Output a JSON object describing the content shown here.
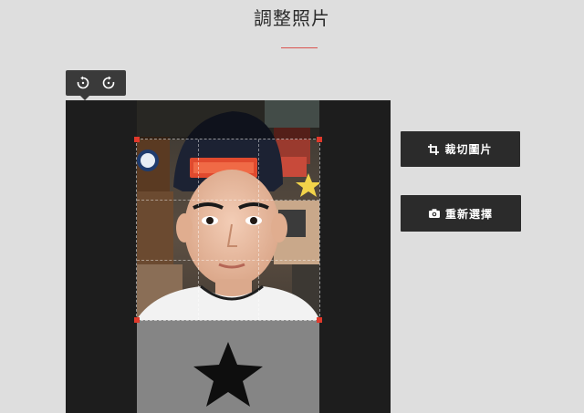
{
  "page": {
    "title": "調整照片"
  },
  "toolbar": {
    "rotate_left_icon": "rotate-left-icon",
    "rotate_right_icon": "rotate-right-icon"
  },
  "actions": {
    "crop_label": "裁切圖片",
    "crop_icon": "crop-icon",
    "reselect_label": "重新選擇",
    "reselect_icon": "camera-icon"
  },
  "colors": {
    "accent": "#d9534f",
    "handle": "#e0392b",
    "button_bg": "#2b2b2b",
    "stage_bg": "#1d1d1d",
    "page_bg": "#dedede"
  }
}
